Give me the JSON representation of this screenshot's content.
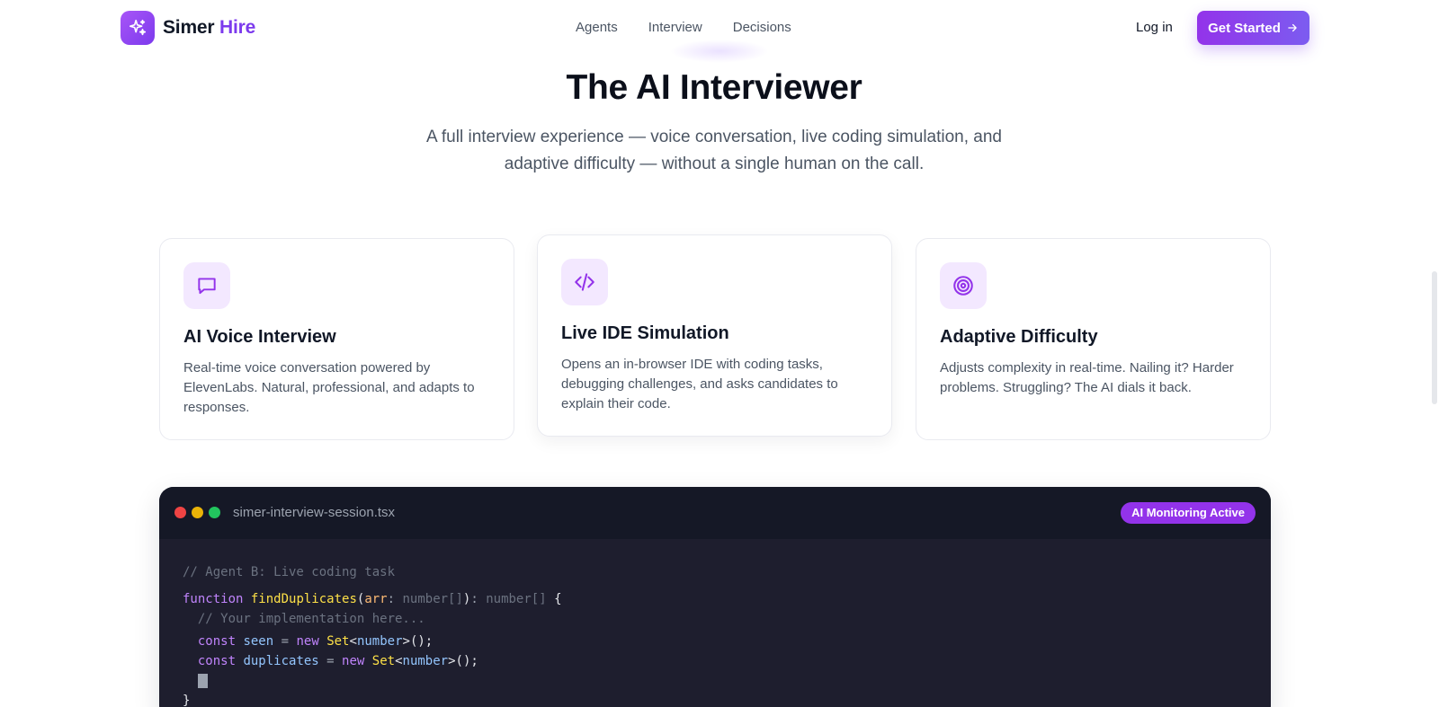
{
  "brand": {
    "name_part1": "Simer",
    "name_part2": "Hire",
    "logo_icon": "sparkle-icon"
  },
  "nav": {
    "links": [
      {
        "label": "Agents"
      },
      {
        "label": "Interview"
      },
      {
        "label": "Decisions"
      }
    ],
    "login_label": "Log in",
    "cta_label": "Get Started",
    "cta_icon": "arrow-right-icon"
  },
  "hero": {
    "title": "The AI Interviewer",
    "subtitle": "A full interview experience — voice conversation, live coding simulation, and adaptive difficulty — without a single human on the call."
  },
  "features": [
    {
      "icon": "chat-bubble-icon",
      "title": "AI Voice Interview",
      "description": "Real-time voice conversation powered by ElevenLabs. Natural, professional, and adapts to responses."
    },
    {
      "icon": "code-icon",
      "title": "Live IDE Simulation",
      "description": "Opens an in-browser IDE with coding tasks, debugging challenges, and asks candidates to explain their code."
    },
    {
      "icon": "target-icon",
      "title": "Adaptive Difficulty",
      "description": "Adjusts complexity in real-time. Nailing it? Harder problems. Struggling? The AI dials it back."
    }
  ],
  "code_window": {
    "filename": "simer-interview-session.tsx",
    "badge": "AI Monitoring Active",
    "lines": {
      "comment1": "// Agent B: Live coding task",
      "kw_function": "function",
      "fn_name": "findDuplicates",
      "param": "arr",
      "param_type": "number[]",
      "return_type": "number[]",
      "comment2": "// Your implementation here...",
      "kw_const": "const",
      "var_seen": "seen",
      "kw_new": "new",
      "class_set": "Set",
      "generic": "number",
      "var_duplicates": "duplicates",
      "closing": "}"
    }
  },
  "colors": {
    "accent": "#7c3aed",
    "cta_start": "#9333ea",
    "icon_bg": "#f3e8ff",
    "code_bg": "#1e1e2e"
  }
}
